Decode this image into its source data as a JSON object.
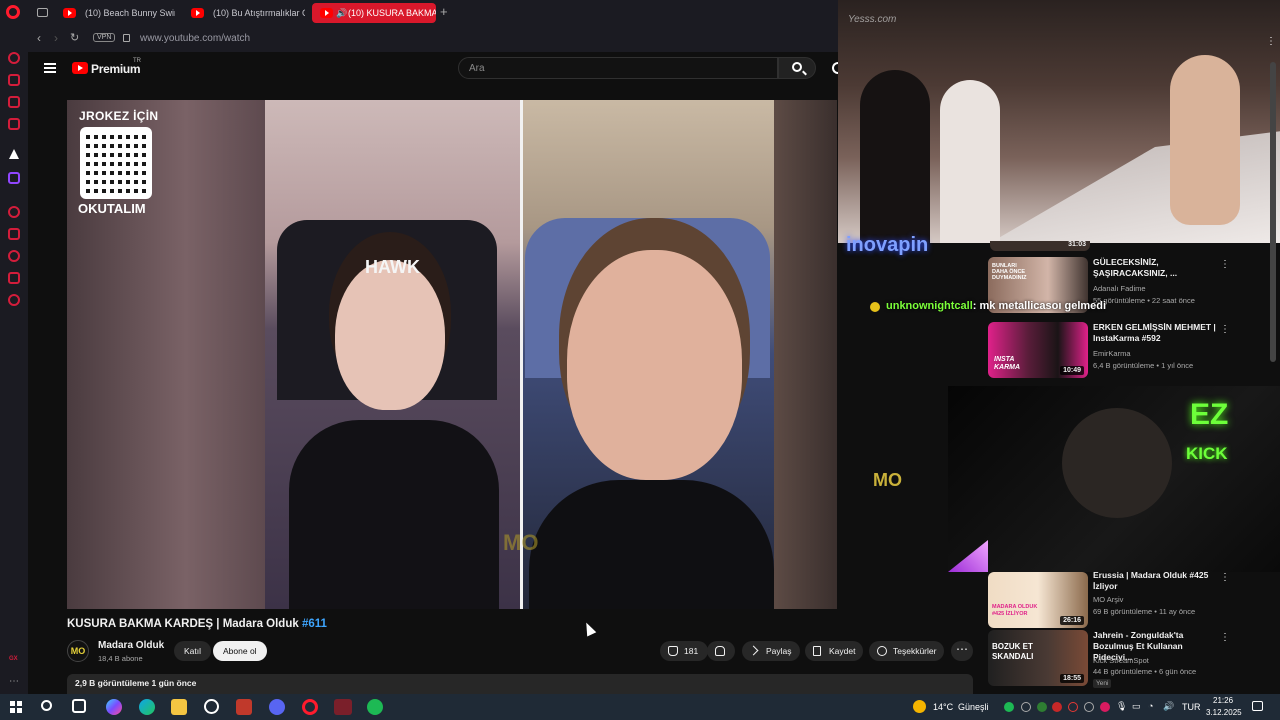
{
  "browser": {
    "tabs": [
      {
        "label": "(10) Beach Bunny Swimw"
      },
      {
        "label": "(10) Bu Atıştırmalıklar Gen"
      },
      {
        "label": "(10) KUSURA BAKMA"
      }
    ],
    "vpn_label": "VPN",
    "url": "www.youtube.com/watch"
  },
  "youtube": {
    "logo_text": "Premium",
    "logo_region": "TR",
    "search_placeholder": "Ara"
  },
  "player": {
    "qr_title": "JROKEZ İÇİN",
    "qr_subtitle": "OKUTALIM",
    "chair_brand": "HAWK",
    "watermark_logo": "MO"
  },
  "video": {
    "title": "KUSURA BAKMA KARDEŞ | Madara Olduk",
    "hashtag": "#611",
    "channel_name": "Madara Olduk",
    "channel_subs": "18,4 B abone",
    "channel_avatar_text": "MO",
    "join_label": "Katıl",
    "subscribe_label": "Abone ol",
    "like_count": "181",
    "share_label": "Paylaş",
    "save_label": "Kaydet",
    "thanks_label": "Teşekkürler",
    "views_date": "2,9 B görüntüleme  1 gün önce"
  },
  "overlays": {
    "top_watermark": "Yesss.com",
    "sponsor_text": "inovapin",
    "chat_user": "unknownightcall",
    "chat_message": ": mk metallicasoı gelmedi",
    "ez_text": "EZ",
    "kick_text": "KICK"
  },
  "recommendations": [
    {
      "title": "GÜLECEKSİNİZ, ŞAŞIRACAKSINIZ, ...",
      "channel": "Adanalı Fadime",
      "meta": "55 görüntüleme • 22 saat önce",
      "duration": "",
      "thumb_text": "BUNLARI DAHA ÖNCE DUYMADINIZ"
    },
    {
      "title": "ERKEN GELMİŞSİN MEHMET | InstaKarma #592",
      "channel": "EmirKarma",
      "meta": "6,4 B görüntüleme • 1 yıl önce",
      "duration": "10:49",
      "thumb_text": "INSTA KARMA"
    },
    {
      "title": "Erussia | Madara Olduk #425 İzliyor",
      "channel": "MO Arşiv",
      "meta": "69 B görüntüleme • 11 ay önce",
      "duration": "26:16",
      "thumb_text": "MADARA OLDUK #425 İZLİYOR"
    },
    {
      "title": "Jahrein - Zonguldak'ta Bozulmuş Et Kullanan Pideciyi...",
      "channel": "Kick StreamSpot",
      "meta": "44 B görüntüleme • 6 gün önce",
      "duration": "18:55",
      "thumb_text": "BOZUK ET SKANDALI",
      "badge": "Yeni"
    }
  ],
  "top_rec_duration": "31:03",
  "taskbar": {
    "weather_temp": "14°C",
    "weather_label": "Güneşli",
    "language": "TUR",
    "time": "21:26",
    "date": "3.12.2025"
  },
  "colors": {
    "opera_red": "#ff1b2d",
    "youtube_red": "#ff0000",
    "link_blue": "#3ea6ff",
    "kick_green": "#6dff3a"
  }
}
